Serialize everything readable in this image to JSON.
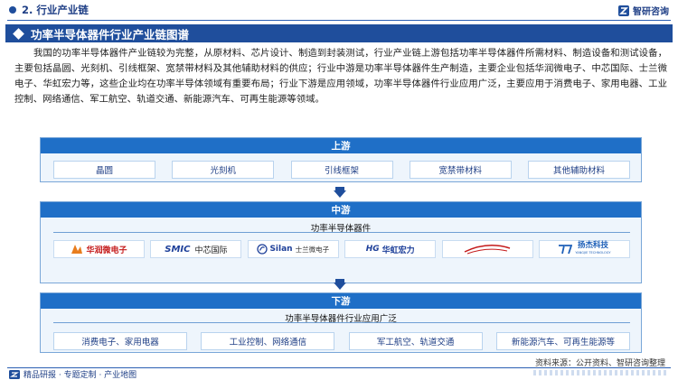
{
  "header": {
    "section": "2. 行业产业链",
    "brand": "智研咨询"
  },
  "title": "功率半导体器件行业产业链图谱",
  "paragraph": "我国的功率半导体器件产业链较为完整，从原材料、芯片设计、制造到封装测试，行业产业链上游包括功率半导体器件所需材料、制造设备和测试设备，主要包括晶圆、光刻机、引线框架、宽禁带材料及其他辅助材料的供应；行业中游是功率半导体器件生产制造，主要企业包括华润微电子、中芯国际、士兰微电子、华虹宏力等，这些企业均在功率半导体领域有重要布局；行业下游是应用领域，功率半导体器件行业应用广泛，主要应用于消费电子、家用电器、工业控制、网络通信、军工航空、轨道交通、新能源汽车、可再生能源等领域。",
  "upstream": {
    "title": "上游",
    "items": [
      "晶圆",
      "光刻机",
      "引线框架",
      "宽禁带材料",
      "其他辅助材料"
    ]
  },
  "midstream": {
    "title": "中游",
    "subtitle": "功率半导体器件",
    "logos": [
      {
        "text": "华润微电子",
        "color": "#c41a1a"
      },
      {
        "brand": "SMIC",
        "text": "中芯国际",
        "color": "#1d3f99"
      },
      {
        "brand": "Silan",
        "text": "士兰微电子",
        "color": "#1d3f99"
      },
      {
        "brand": "HG",
        "text": "华虹宏力",
        "color": "#1d3f99"
      },
      {
        "text": "",
        "color": "#c41a1a"
      },
      {
        "text": "扬杰科技",
        "sub": "YANGJIE TECHNOLOGY",
        "color": "#1d5fb8"
      }
    ]
  },
  "downstream": {
    "title": "下游",
    "subtitle": "功率半导体器件行业应用广泛",
    "items": [
      "消费电子、家用电器",
      "工业控制、网络通信",
      "军工航空、轨道交通",
      "新能源汽车、可再生能源等"
    ]
  },
  "footer": {
    "source": "资料来源：公开资料、智研咨询整理",
    "left": "精品研报 · 专题定制 · 产业地图"
  }
}
